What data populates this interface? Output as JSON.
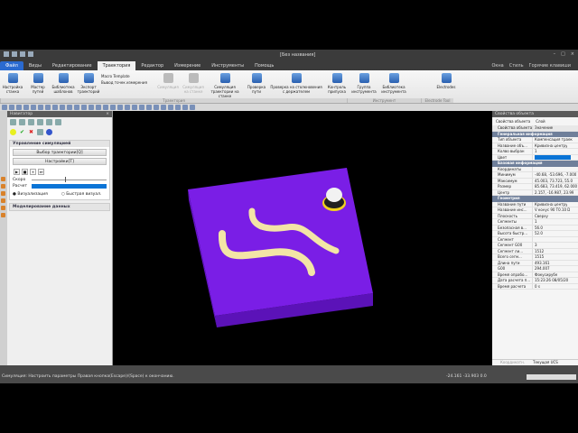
{
  "window": {
    "title": "[Без названия]",
    "controls": [
      "–",
      "□",
      "×"
    ]
  },
  "menu": {
    "items": [
      "Файл",
      "Виды",
      "Редактирование",
      "Траектория",
      "Редактор",
      "Измерение",
      "Инструменты",
      "Помощь"
    ],
    "active": "Траектория",
    "right": [
      "Окна",
      "Стиль",
      "Горячие клавиши"
    ]
  },
  "ribbon": {
    "buttons": [
      "Настройка станка",
      "Мастер путей",
      "Библиотека шаблонов",
      "Экспорт траекторий"
    ],
    "small": [
      "Macro Template",
      "Вывод точек измерения"
    ],
    "buttons2": [
      "Симуляция",
      "Симуляция на станке",
      "Симуляция траектории на станке",
      "Проверка пути",
      "Проверка на столкновения с держателем",
      "Контроль припуска"
    ],
    "buttons3": [
      "Группа инструмента",
      "Библиотека инструмента"
    ],
    "buttons4": [
      "Electrodes"
    ],
    "groups": [
      "Траектория",
      "Инструмент",
      "Electrode Tool"
    ]
  },
  "navigator": {
    "title": "Навигатор",
    "close": "×",
    "sim": {
      "header": "Управление симуляцией",
      "select_btn": "Выбор траектории[Q]",
      "settings_btn": "Настройки[T]",
      "playback": [
        "▶",
        "■",
        "⏸",
        "⏭"
      ],
      "speed_label": "Скоро",
      "calc_label": "Расчет",
      "calc_progress": 100,
      "radio_vis": "Визуализация",
      "radio_fast": "Быстрая визуал.",
      "selected": "Визуализация"
    },
    "data_header": "Моделирование данных"
  },
  "properties": {
    "title": "Свойства объекта",
    "tabs": [
      "Свойства объекта",
      "Слой"
    ],
    "col_headers": [
      "Свойства объекта",
      "Значение"
    ],
    "sections": [
      {
        "name": "Генеральная информация",
        "rows": [
          [
            "Тип объекта",
            "Компенсация траек"
          ],
          [
            "Название объ...",
            "Кривизна центру"
          ],
          [
            "Колво выбран",
            "1"
          ],
          [
            "Цвет",
            ""
          ]
        ]
      },
      {
        "name": "Базовая информация",
        "rows": [
          [
            "Координаты",
            ""
          ],
          [
            "Минимум",
            "-40.68, -53.696, -7.000"
          ],
          [
            "Максимум",
            "45.003, 73.723, 55.0"
          ],
          [
            "Размер",
            "85.683, 73.419, 62.000"
          ],
          [
            "Центр",
            "2.157, -16.987, 23.99"
          ]
        ]
      },
      {
        "name": "Геометрия",
        "rows": [
          [
            "Название пути",
            "Кривизна центру"
          ],
          [
            "Название инс...",
            "V конус 90 T0.10 D"
          ],
          [
            "Плоскость",
            "Сверху"
          ],
          [
            "Сегменты",
            "1"
          ],
          [
            "Безопасная в...",
            "56.0"
          ],
          [
            "Высота быстр...",
            "52.0"
          ],
          [
            "Сегмент",
            ""
          ],
          [
            "Сегмент G00",
            "3"
          ],
          [
            "Сегмент ли...",
            "1512"
          ],
          [
            "Всего сегм...",
            "1515"
          ],
          [
            "Длина пути",
            "493.161"
          ],
          [
            "G00",
            "294.007"
          ],
          [
            "Время опрабо...",
            "Фокусирубе"
          ],
          [
            "Дата расчета п...",
            "15:23:26 08/05/20"
          ],
          [
            "Время расчета",
            "0 s"
          ]
        ]
      }
    ],
    "footer": [
      "Координатн.",
      "Текущая UCS"
    ]
  },
  "status": {
    "message": "Симуляция: Настроить параметры Правая кнопка(Escape)/(Space) к окончанию.",
    "coords": "-24.161 -33.903 0.0"
  },
  "colors": {
    "part": "#7a1ee6",
    "part_side": "#5b12b8",
    "toolpath": "#f3e5a6",
    "accent": "#2a6ad0"
  }
}
